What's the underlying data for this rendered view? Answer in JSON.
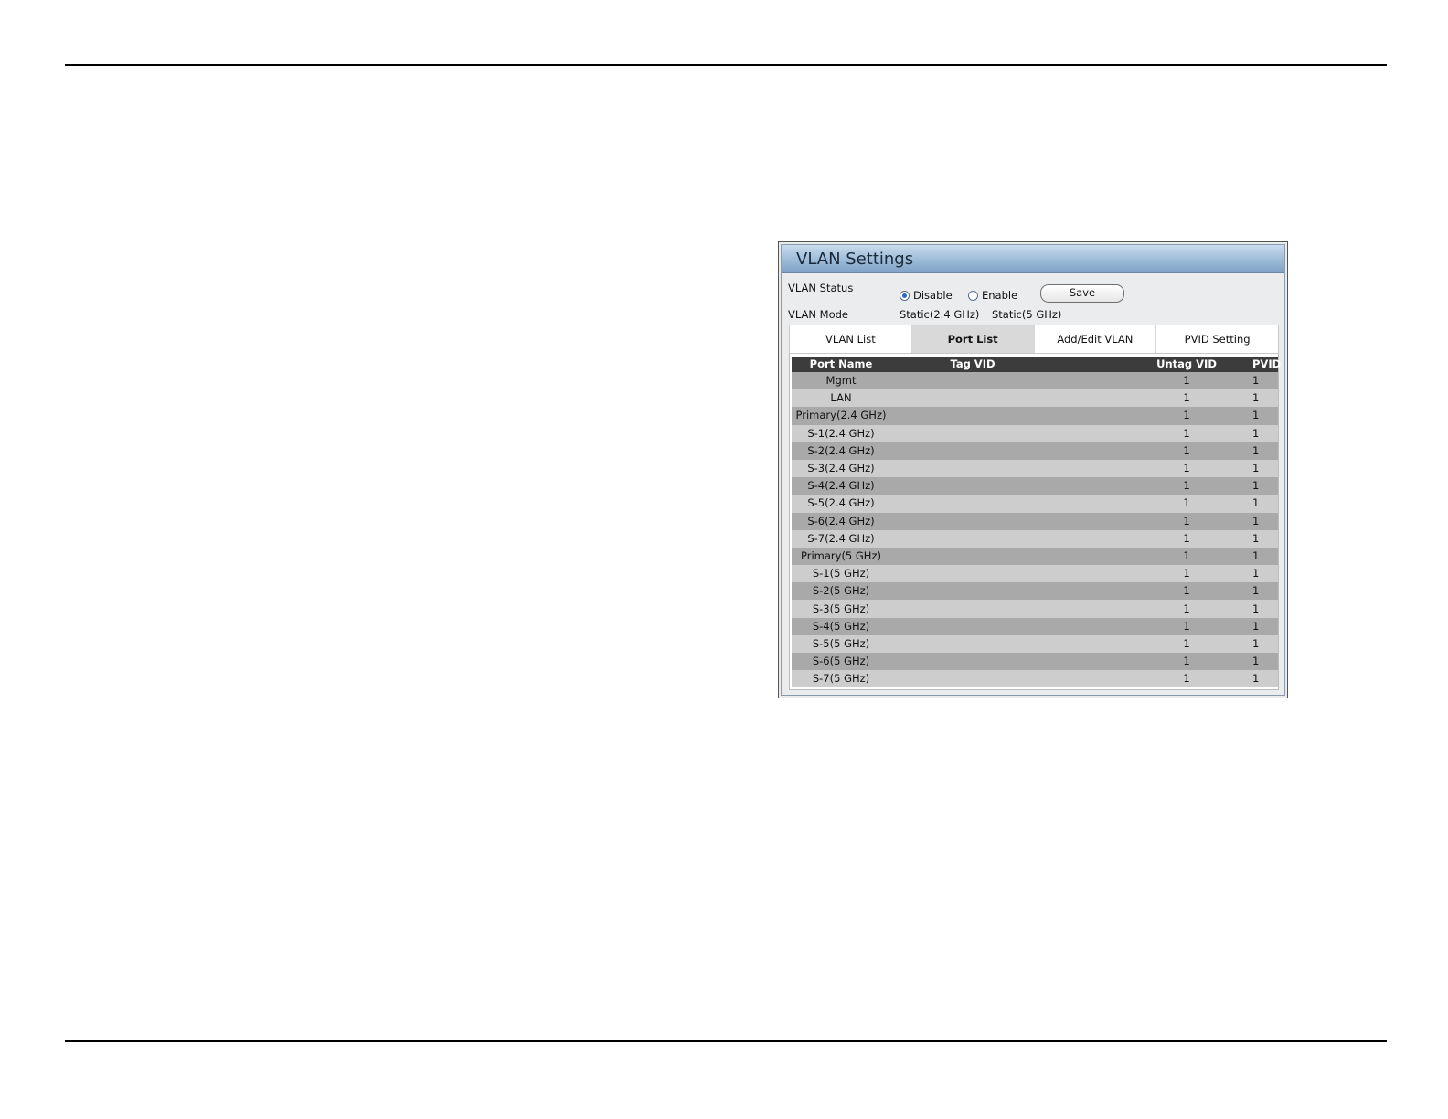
{
  "panel": {
    "title": "VLAN Settings",
    "vlan_status": {
      "label": "VLAN Status",
      "options": [
        "Disable",
        "Enable"
      ],
      "selected": "Disable",
      "save_label": "Save"
    },
    "vlan_mode": {
      "label": "VLAN Mode",
      "values": [
        "Static(2.4 GHz)",
        "Static(5 GHz)"
      ]
    },
    "tabs": [
      "VLAN List",
      "Port List",
      "Add/Edit VLAN",
      "PVID Setting"
    ],
    "active_tab": "Port List",
    "table": {
      "columns": [
        "Port Name",
        "Tag VID",
        "Untag VID",
        "PVID"
      ],
      "rows": [
        [
          "Mgmt",
          "",
          "1",
          "1"
        ],
        [
          "LAN",
          "",
          "1",
          "1"
        ],
        [
          "Primary(2.4 GHz)",
          "",
          "1",
          "1"
        ],
        [
          "S-1(2.4 GHz)",
          "",
          "1",
          "1"
        ],
        [
          "S-2(2.4 GHz)",
          "",
          "1",
          "1"
        ],
        [
          "S-3(2.4 GHz)",
          "",
          "1",
          "1"
        ],
        [
          "S-4(2.4 GHz)",
          "",
          "1",
          "1"
        ],
        [
          "S-5(2.4 GHz)",
          "",
          "1",
          "1"
        ],
        [
          "S-6(2.4 GHz)",
          "",
          "1",
          "1"
        ],
        [
          "S-7(2.4 GHz)",
          "",
          "1",
          "1"
        ],
        [
          "Primary(5 GHz)",
          "",
          "1",
          "1"
        ],
        [
          "S-1(5 GHz)",
          "",
          "1",
          "1"
        ],
        [
          "S-2(5 GHz)",
          "",
          "1",
          "1"
        ],
        [
          "S-3(5 GHz)",
          "",
          "1",
          "1"
        ],
        [
          "S-4(5 GHz)",
          "",
          "1",
          "1"
        ],
        [
          "S-5(5 GHz)",
          "",
          "1",
          "1"
        ],
        [
          "S-6(5 GHz)",
          "",
          "1",
          "1"
        ],
        [
          "S-7(5 GHz)",
          "",
          "1",
          "1"
        ]
      ]
    }
  },
  "colors": {
    "title_bar": "#9dbbd8",
    "header_row": "#3c3c3c",
    "row_dark": "#a9a9a9",
    "row_light": "#cdcdcd",
    "active_tab": "#d9d9d9",
    "radio_selected": "#2f66c7"
  }
}
